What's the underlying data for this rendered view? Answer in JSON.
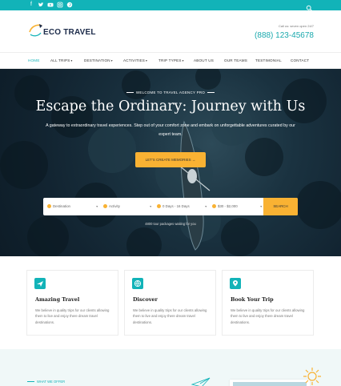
{
  "topbar": {
    "social_icons": [
      "facebook-icon",
      "twitter-icon",
      "youtube-icon",
      "instagram-icon",
      "pinterest-icon"
    ],
    "search_icon": "search-icon",
    "color": "#12b3b8"
  },
  "header": {
    "logo_text": "ECO TRAVEL",
    "call_label": "Call us: seven open 24/7",
    "phone": "(888) 123-45678"
  },
  "nav": {
    "items": [
      {
        "label": "Home",
        "dropdown": false,
        "active": true
      },
      {
        "label": "All Trips",
        "dropdown": true,
        "active": false
      },
      {
        "label": "Destination",
        "dropdown": true,
        "active": false
      },
      {
        "label": "Activities",
        "dropdown": true,
        "active": false
      },
      {
        "label": "Trip Types",
        "dropdown": true,
        "active": false
      },
      {
        "label": "About Us",
        "dropdown": false,
        "active": false
      },
      {
        "label": "Our Teams",
        "dropdown": false,
        "active": false
      },
      {
        "label": "Testimonial",
        "dropdown": false,
        "active": false
      },
      {
        "label": "Contact",
        "dropdown": false,
        "active": false
      }
    ]
  },
  "hero": {
    "eyebrow": "Welcome to Travel Agency Pro",
    "title": "Escape the Ordinary: Journey with Us",
    "subtitle": "A gateway to extraordinary travel experiences. Step out of your comfort zone and embark on unforgettable adventures curated by our expert team.",
    "cta_label": "Let's Create Memories →",
    "search": {
      "destination": "Destination",
      "activity": "Activity",
      "duration": "0 Days - 16 Days",
      "price": "$30 - $2,000",
      "button": "Search"
    },
    "packages_note": "4800 tour packages waiting for you"
  },
  "features": [
    {
      "title": "Amazing Travel",
      "desc": "We believe in quality trips for our clients allowing them to live and enjoy there dream travel destinations.",
      "icon": "plane-icon"
    },
    {
      "title": "Discover",
      "desc": "We believe in quality trips for our clients allowing them to live and enjoy there dream travel destinations.",
      "icon": "globe-icon"
    },
    {
      "title": "Book Your Trip",
      "desc": "We believe in quality trips for our clients allowing them to live and enjoy there dream travel destinations.",
      "icon": "map-pin-icon"
    }
  ],
  "offer": {
    "label": "What we offer"
  },
  "colors": {
    "accent": "#12b3b8",
    "cta": "#f9b233",
    "brand_dark": "#1c2b4a"
  }
}
